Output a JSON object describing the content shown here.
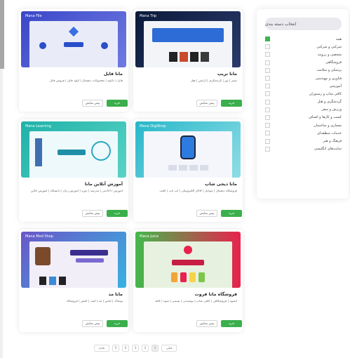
{
  "sidebar": {
    "title": "انتخاب دسته بندی",
    "items": [
      {
        "label": "همه",
        "checked": true
      },
      {
        "label": "شرکتی و شرکتی",
        "checked": false
      },
      {
        "label": "شخصی و رزومه",
        "checked": false
      },
      {
        "label": "فروشگاهی",
        "checked": false
      },
      {
        "label": "پزشکی و سلامت",
        "checked": false
      },
      {
        "label": "فناوری و مهندسی",
        "checked": false
      },
      {
        "label": "آموزشی",
        "checked": false
      },
      {
        "label": "کافی شاپ و رستوران",
        "checked": false
      },
      {
        "label": "گردشگری و هتل",
        "checked": false
      },
      {
        "label": "ورزش و سفر",
        "checked": false
      },
      {
        "label": "کسب و کارها و اصناف",
        "checked": false
      },
      {
        "label": "معماری و ساختمان",
        "checked": false
      },
      {
        "label": "خدمات منطقه‌ای",
        "checked": false
      },
      {
        "label": "فرهنگ و هنر",
        "checked": false
      },
      {
        "label": "سایت‌های انگلیسی",
        "checked": false
      }
    ]
  },
  "cards": [
    {
      "thumb_label": "Mana Trip",
      "title": "مانا تریپ",
      "desc": "سفر | تور | گردشگری | آژانس | هتل",
      "buy": "خرید",
      "demo": "پیش نمایش",
      "colors": [
        "#0b1a3a",
        "#f2f4f8"
      ]
    },
    {
      "thumb_label": "Mana File",
      "title": "مانا فایل",
      "desc": "فایل | دانلود | محصولات دیجیتال | آپلود فایل | فروش فایل",
      "buy": "خرید",
      "demo": "پیش نمایش",
      "colors": [
        "#3a47c8",
        "#e9ecf8"
      ]
    },
    {
      "thumb_label": "Mana DigiShop",
      "title": "مانا دیجی شاپ",
      "desc": "فروشگاه دیجیتال | موبایل | کالای الکترونیکی | لپ تاپ | گجت",
      "buy": "خرید",
      "demo": "پیش نمایش",
      "colors": [
        "#27b7c9",
        "#f4f6fb"
      ]
    },
    {
      "thumb_label": "Mana Learning",
      "title": "آموزش آنلاین مانا",
      "desc": "آموزش | آکادمی | مدرسه | دوره | آموزش زبان | دانشگاه | آموزش آنلاین",
      "buy": "خرید",
      "demo": "پیش نمایش",
      "colors": [
        "#1fb1a8",
        "#eef9fb"
      ]
    },
    {
      "thumb_label": "Mana Juice",
      "title": "فروشگاه مانا فروت",
      "desc": "آبمیوه | فروشگاهی | کافی شاپ | نوشیدنی | بستنی | میوه | کافه",
      "buy": "خرید",
      "demo": "پیش نمایش",
      "colors": [
        "#e8224c",
        "#e7f1df"
      ]
    },
    {
      "thumb_label": "Mana Mod Shop",
      "title": "مانا مد",
      "desc": "پوشاک | لباس | مد | کیف | کفش | فروشگاه",
      "buy": "خرید",
      "demo": "پیش نمایش",
      "colors": [
        "#6a56c8",
        "#f1eef8"
      ]
    }
  ],
  "pagination": {
    "next": "بعدی",
    "pages": [
      "5",
      "4",
      "3",
      "2",
      "1"
    ],
    "prev": "قبلی"
  }
}
